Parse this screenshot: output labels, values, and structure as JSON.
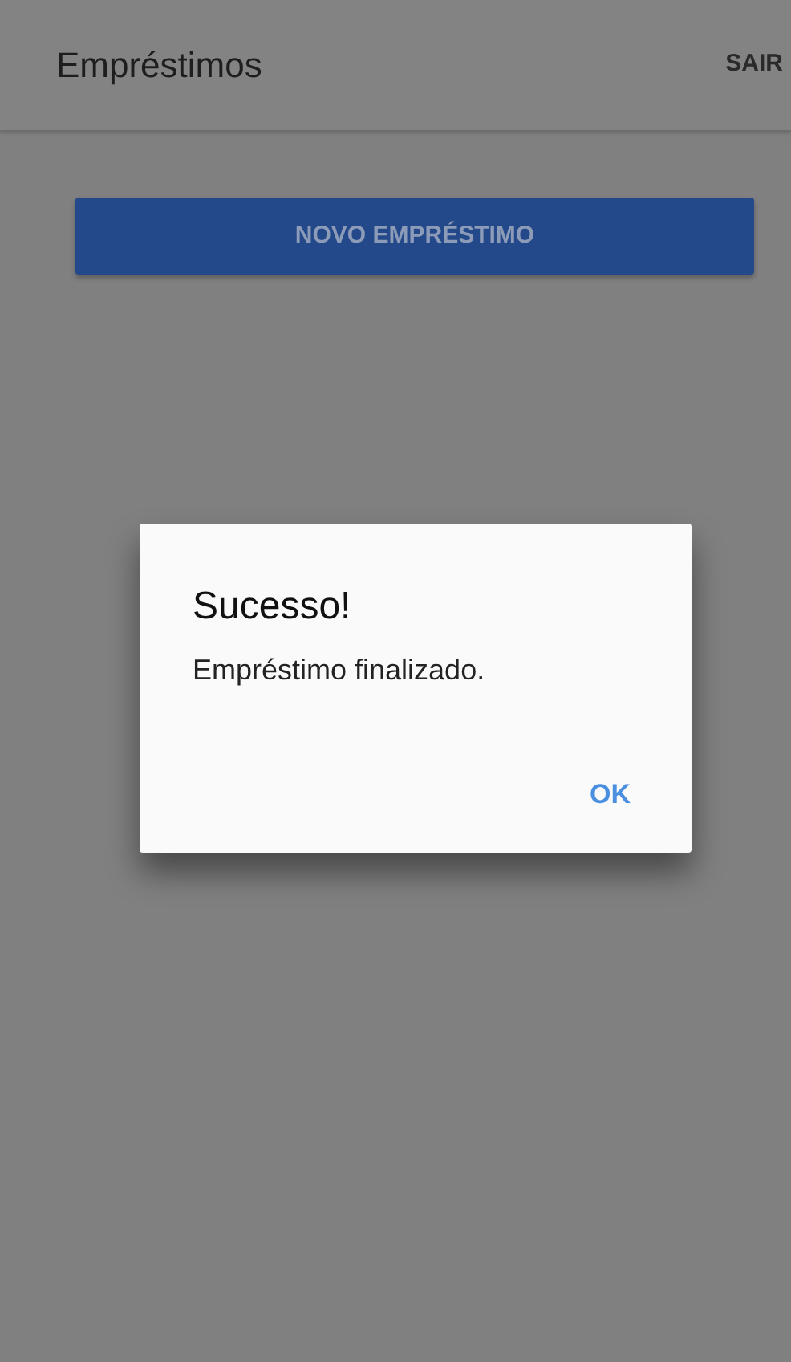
{
  "app_bar": {
    "title": "Empréstimos",
    "action": "SAIR"
  },
  "new_loan_button": "NOVO EMPRÉSTIMO",
  "dialog": {
    "title": "Sucesso!",
    "message": "Empréstimo finalizado.",
    "buttons": [
      "OK"
    ]
  }
}
